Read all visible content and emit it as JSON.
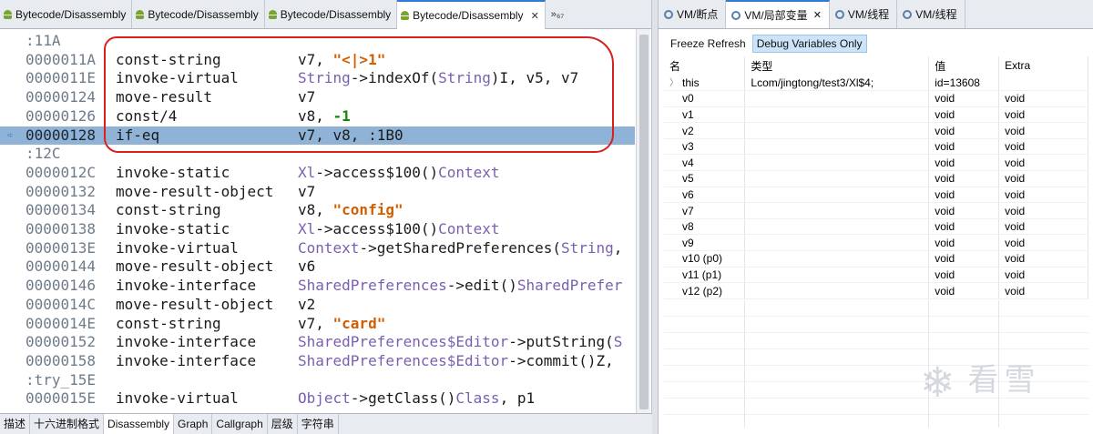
{
  "left": {
    "tabs": [
      {
        "label": "Bytecode/Disassembly",
        "active": false
      },
      {
        "label": "Bytecode/Disassembly",
        "active": false
      },
      {
        "label": "Bytecode/Disassembly",
        "active": false
      },
      {
        "label": "Bytecode/Disassembly",
        "active": true
      }
    ],
    "tab_close": "✕",
    "tab_overflow": "»₆₇",
    "code_lines": [
      {
        "type": "label",
        "text": ":11A"
      },
      {
        "addr": "0000011A",
        "op": "const-string",
        "args": [
          {
            "t": "v7, "
          },
          {
            "t": "\"<|>1\"",
            "c": "str"
          }
        ]
      },
      {
        "addr": "0000011E",
        "op": "invoke-virtual",
        "args": [
          {
            "t": "String",
            "c": "kw"
          },
          {
            "t": "->indexOf("
          },
          {
            "t": "String",
            "c": "kw"
          },
          {
            "t": ")I, v5, v7"
          }
        ]
      },
      {
        "addr": "00000124",
        "op": "move-result",
        "args": [
          {
            "t": "v7"
          }
        ]
      },
      {
        "addr": "00000126",
        "op": "const/4",
        "args": [
          {
            "t": "v8, "
          },
          {
            "t": "-1",
            "c": "num"
          }
        ]
      },
      {
        "addr": "00000128",
        "op": "if-eq",
        "args": [
          {
            "t": "v7, v8, :1B0"
          }
        ],
        "highlighted": true
      },
      {
        "type": "label",
        "text": ":12C"
      },
      {
        "addr": "0000012C",
        "op": "invoke-static",
        "args": [
          {
            "t": "Xl",
            "c": "kw"
          },
          {
            "t": "->access$100()"
          },
          {
            "t": "Context",
            "c": "kw"
          }
        ]
      },
      {
        "addr": "00000132",
        "op": "move-result-object",
        "args": [
          {
            "t": "v7"
          }
        ]
      },
      {
        "addr": "00000134",
        "op": "const-string",
        "args": [
          {
            "t": "v8, "
          },
          {
            "t": "\"config\"",
            "c": "str"
          }
        ]
      },
      {
        "addr": "00000138",
        "op": "invoke-static",
        "args": [
          {
            "t": "Xl",
            "c": "kw"
          },
          {
            "t": "->access$100()"
          },
          {
            "t": "Context",
            "c": "kw"
          }
        ]
      },
      {
        "addr": "0000013E",
        "op": "invoke-virtual",
        "args": [
          {
            "t": "Context",
            "c": "kw"
          },
          {
            "t": "->getSharedPreferences("
          },
          {
            "t": "String",
            "c": "kw"
          },
          {
            "t": ","
          }
        ]
      },
      {
        "addr": "00000144",
        "op": "move-result-object",
        "args": [
          {
            "t": "v6"
          }
        ]
      },
      {
        "addr": "00000146",
        "op": "invoke-interface",
        "args": [
          {
            "t": "SharedPreferences",
            "c": "kw"
          },
          {
            "t": "->edit()"
          },
          {
            "t": "SharedPrefer",
            "c": "kw"
          }
        ]
      },
      {
        "addr": "0000014C",
        "op": "move-result-object",
        "args": [
          {
            "t": "v2"
          }
        ]
      },
      {
        "addr": "0000014E",
        "op": "const-string",
        "args": [
          {
            "t": "v7, "
          },
          {
            "t": "\"card\"",
            "c": "str"
          }
        ]
      },
      {
        "addr": "00000152",
        "op": "invoke-interface",
        "args": [
          {
            "t": "SharedPreferences$Editor",
            "c": "kw"
          },
          {
            "t": "->putString("
          },
          {
            "t": "S",
            "c": "kw"
          }
        ]
      },
      {
        "addr": "00000158",
        "op": "invoke-interface",
        "args": [
          {
            "t": "SharedPreferences$Editor",
            "c": "kw"
          },
          {
            "t": "->commit()Z,"
          }
        ]
      },
      {
        "type": "label",
        "text": ":try_15E"
      },
      {
        "addr": "0000015E",
        "op": "invoke-virtual",
        "args": [
          {
            "t": "Object",
            "c": "kw"
          },
          {
            "t": "->getClass()"
          },
          {
            "t": "Class",
            "c": "kw"
          },
          {
            "t": ", p1"
          }
        ]
      }
    ],
    "bottom_tabs": [
      {
        "label": "描述",
        "active": false
      },
      {
        "label": "十六进制格式",
        "active": false
      },
      {
        "label": "Disassembly",
        "active": true
      },
      {
        "label": "Graph",
        "active": false
      },
      {
        "label": "Callgraph",
        "active": false
      },
      {
        "label": "层级",
        "active": false
      },
      {
        "label": "字符串",
        "active": false
      }
    ]
  },
  "right": {
    "tabs": [
      {
        "label": "VM/断点",
        "active": false
      },
      {
        "label": "VM/局部变量",
        "active": true
      },
      {
        "label": "VM/线程",
        "active": false
      },
      {
        "label": "VM/线程",
        "active": false
      }
    ],
    "toolbar": {
      "freeze": "Freeze Refresh",
      "debug_only": "Debug Variables Only"
    },
    "table": {
      "headers": [
        "名",
        "类型",
        "值",
        "Extra"
      ],
      "rows": [
        {
          "name": "this",
          "type": "Lcom/jingtong/test3/Xl$4;",
          "value": "id=13608",
          "extra": "",
          "expandable": true
        },
        {
          "name": "v0",
          "type": "",
          "value": "void",
          "extra": "void"
        },
        {
          "name": "v1",
          "type": "",
          "value": "void",
          "extra": "void"
        },
        {
          "name": "v2",
          "type": "",
          "value": "void",
          "extra": "void"
        },
        {
          "name": "v3",
          "type": "",
          "value": "void",
          "extra": "void"
        },
        {
          "name": "v4",
          "type": "",
          "value": "void",
          "extra": "void"
        },
        {
          "name": "v5",
          "type": "",
          "value": "void",
          "extra": "void"
        },
        {
          "name": "v6",
          "type": "",
          "value": "void",
          "extra": "void"
        },
        {
          "name": "v7",
          "type": "",
          "value": "void",
          "extra": "void"
        },
        {
          "name": "v8",
          "type": "",
          "value": "void",
          "extra": "void"
        },
        {
          "name": "v9",
          "type": "",
          "value": "void",
          "extra": "void"
        },
        {
          "name": "v10 (p0)",
          "type": "",
          "value": "void",
          "extra": "void"
        },
        {
          "name": "v11 (p1)",
          "type": "",
          "value": "void",
          "extra": "void"
        },
        {
          "name": "v12 (p2)",
          "type": "",
          "value": "void",
          "extra": "void"
        }
      ]
    }
  },
  "watermark": "看雪",
  "colors": {
    "highlight": "#8fb3d6",
    "keyword": "#7a5fb0",
    "string": "#d25e00",
    "number": "#0f8a00",
    "annotation": "#d8211f"
  }
}
